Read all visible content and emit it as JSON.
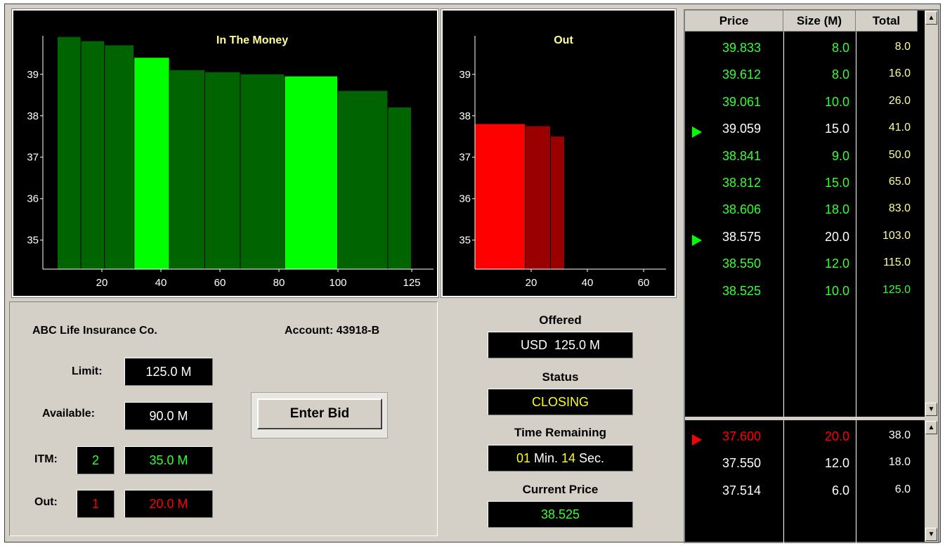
{
  "colors": {
    "itm_bright": "#00ff00",
    "itm_dark": "#006400",
    "out_bright": "#ff0000",
    "out_dark": "#9a0000",
    "green_text": "#33ff33",
    "red_text": "#ff0000",
    "yellow_text": "#ffff00"
  },
  "chart_data": [
    {
      "type": "bar",
      "title": "In The Money",
      "x_edges": [
        5,
        13,
        21,
        31,
        43,
        55,
        67,
        82,
        100,
        117,
        125
      ],
      "values": [
        39.9,
        39.8,
        39.7,
        39.4,
        39.1,
        39.05,
        39.0,
        38.95,
        38.6,
        38.2
      ],
      "highlight": [
        false,
        false,
        false,
        true,
        false,
        false,
        false,
        true,
        false,
        false
      ],
      "xlim": [
        0,
        130
      ],
      "ylim": [
        34.3,
        40.2
      ],
      "xticks": [
        20,
        40,
        60,
        80,
        100,
        125
      ],
      "yticks": [
        35,
        36,
        37,
        38,
        39
      ]
    },
    {
      "type": "bar",
      "title": "Out",
      "x_edges": [
        0,
        18,
        27,
        32
      ],
      "values": [
        37.8,
        37.75,
        37.5
      ],
      "highlight": [
        true,
        false,
        false
      ],
      "xlim": [
        0,
        68
      ],
      "ylim": [
        34.3,
        40.2
      ],
      "xticks": [
        20,
        40,
        60
      ],
      "yticks": [
        35,
        36,
        37,
        38,
        39
      ]
    }
  ],
  "client": {
    "name": "ABC Life Insurance Co.",
    "account": "Account: 43918-B"
  },
  "fields": {
    "limit_label": "Limit:",
    "limit_value": "125.0 M",
    "available_label": "Available:",
    "available_value": "90.0 M",
    "itm_label": "ITM:",
    "itm_count": "2",
    "itm_value": "35.0 M",
    "out_label": "Out:",
    "out_count": "1",
    "out_value": "20.0 M"
  },
  "enter_bid": "Enter Bid",
  "auction": {
    "offered_label": "Offered",
    "offered_value": "USD  125.0 M",
    "status_label": "Status",
    "status_value": "CLOSING",
    "time_label": "Time Remaining",
    "time_min": "01",
    "time_min_unit": " Min. ",
    "time_sec": "14",
    "time_sec_unit": " Sec.",
    "price_label": "Current Price",
    "price_value": "38.525"
  },
  "book": {
    "headers": [
      "Price",
      "Size (M)",
      "Total"
    ],
    "upper": [
      {
        "price": "39.833",
        "size": "8.0",
        "total": "8.0",
        "mine": false
      },
      {
        "price": "39.612",
        "size": "8.0",
        "total": "16.0",
        "mine": false
      },
      {
        "price": "39.061",
        "size": "10.0",
        "total": "26.0",
        "mine": false
      },
      {
        "price": "39.059",
        "size": "15.0",
        "total": "41.0",
        "mine": true
      },
      {
        "price": "38.841",
        "size": "9.0",
        "total": "50.0",
        "mine": false
      },
      {
        "price": "38.812",
        "size": "15.0",
        "total": "65.0",
        "mine": false
      },
      {
        "price": "38.606",
        "size": "18.0",
        "total": "83.0",
        "mine": false
      },
      {
        "price": "38.575",
        "size": "20.0",
        "total": "103.0",
        "mine": true
      },
      {
        "price": "38.550",
        "size": "12.0",
        "total": "115.0",
        "mine": false
      },
      {
        "price": "38.525",
        "size": "10.0",
        "total": "125.0",
        "mine": false
      }
    ],
    "lower": [
      {
        "price": "37.600",
        "size": "20.0",
        "total": "38.0",
        "mine": true
      },
      {
        "price": "37.550",
        "size": "12.0",
        "total": "18.0",
        "mine": false
      },
      {
        "price": "37.514",
        "size": "6.0",
        "total": "6.0",
        "mine": false
      }
    ]
  }
}
